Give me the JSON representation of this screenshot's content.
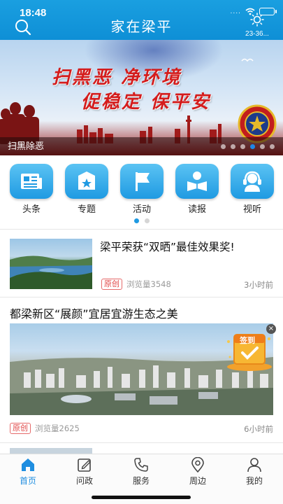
{
  "status_bar": {
    "time": "18:48",
    "dots": "....",
    "network": "",
    "battery": ""
  },
  "header": {
    "title": "家在梁平",
    "weather_temp": "23-36..."
  },
  "banner": {
    "slogan_line1": "扫黑恶 净环境",
    "slogan_line2": "促稳定 保平安",
    "caption": "扫黑除恶",
    "slide_count": 6,
    "active_slide": 4
  },
  "categories": [
    {
      "label": "头条",
      "icon": "newspaper-icon"
    },
    {
      "label": "专题",
      "icon": "star-badge-icon"
    },
    {
      "label": "活动",
      "icon": "flag-icon"
    },
    {
      "label": "读报",
      "icon": "reader-icon"
    },
    {
      "label": "视听",
      "icon": "headset-icon"
    }
  ],
  "category_pages": {
    "count": 2,
    "active": 1
  },
  "news": [
    {
      "title": "梁平荣获“双晒”最佳效果奖!",
      "tag": "原创",
      "views": "浏览量3548",
      "time": "3小时前"
    },
    {
      "title": "都梁新区“展颜”宜居宜游生态之美",
      "tag": "原创",
      "views": "浏览量2625",
      "time": "6小时前"
    }
  ],
  "checkin": {
    "label": "签到",
    "close": "×"
  },
  "tabbar": [
    {
      "label": "首页",
      "icon": "home-icon",
      "active": true
    },
    {
      "label": "问政",
      "icon": "edit-icon",
      "active": false
    },
    {
      "label": "服务",
      "icon": "phone-icon",
      "active": false
    },
    {
      "label": "周边",
      "icon": "location-pin-icon",
      "active": false
    },
    {
      "label": "我的",
      "icon": "user-icon",
      "active": false
    }
  ],
  "colors": {
    "primary": "#1f8ee0",
    "header": "#1a9fe0",
    "tag_red": "#e04545",
    "slogan_red": "#d41c1c"
  }
}
